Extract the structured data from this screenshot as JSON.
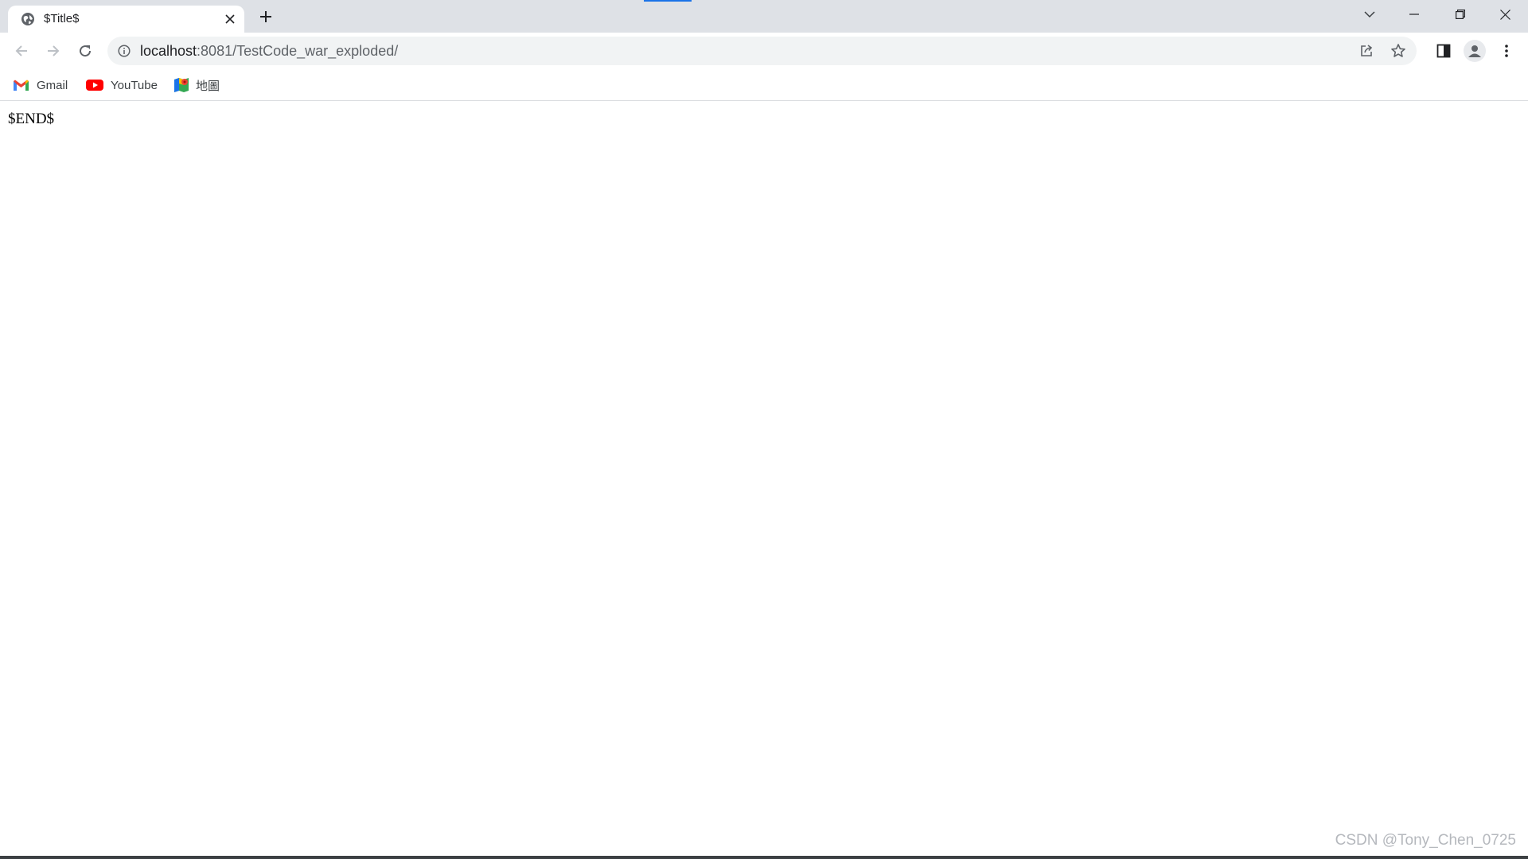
{
  "tab": {
    "title": "$Title$",
    "favicon": "globe-icon"
  },
  "window_controls": [
    "chevron-down-icon",
    "minimize-icon",
    "restore-icon",
    "close-icon"
  ],
  "toolbar": {
    "back": "back-arrow-icon",
    "forward": "forward-arrow-icon",
    "reload": "reload-icon",
    "url_host": "localhost",
    "url_path": ":8081/TestCode_war_exploded/",
    "omnibox_actions": [
      "share-icon",
      "bookmark-star-icon"
    ],
    "side_panel": "side-panel-icon",
    "profile": "profile-icon",
    "menu": "more-vert-icon"
  },
  "bookmarks": [
    {
      "label": "Gmail",
      "icon": "gmail-icon"
    },
    {
      "label": "YouTube",
      "icon": "youtube-icon"
    },
    {
      "label": "地圖",
      "icon": "maps-icon"
    }
  ],
  "page": {
    "body_text": "$END$"
  },
  "watermark": "CSDN @Tony_Chen_0725",
  "colors": {
    "tabstrip": "#dee1e6",
    "omnibox": "#f1f3f4",
    "loading_accent": "#1a73e8"
  }
}
